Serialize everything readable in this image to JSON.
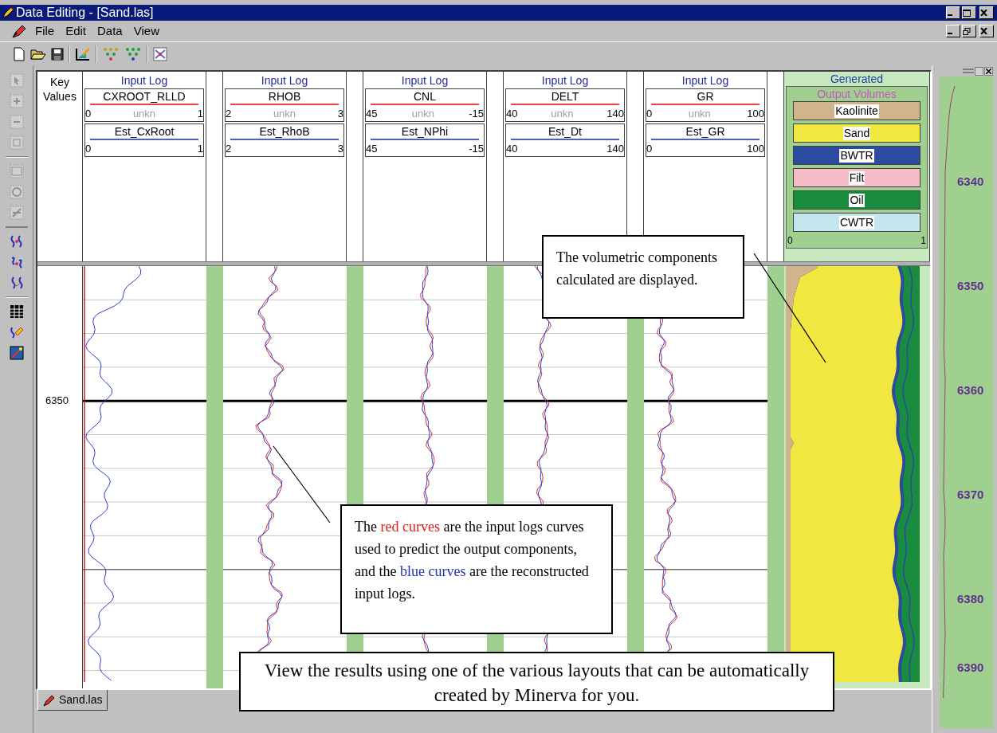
{
  "window": {
    "title": "Data Editing - [Sand.las]"
  },
  "menu": [
    "File",
    "Edit",
    "Data",
    "View"
  ],
  "key_values": {
    "label": "Key Values",
    "depth_label": "6350"
  },
  "tracks": [
    {
      "title": "Input Log",
      "input": {
        "name": "CXROOT_RLLD",
        "min": "0",
        "status": "unkn",
        "max": "1"
      },
      "estimated": {
        "name": "Est_CxRoot",
        "min": "0",
        "max": "1"
      }
    },
    {
      "title": "Input Log",
      "input": {
        "name": "RHOB",
        "min": "2",
        "status": "unkn",
        "max": "3"
      },
      "estimated": {
        "name": "Est_RhoB",
        "min": "2",
        "max": "3"
      }
    },
    {
      "title": "Input Log",
      "input": {
        "name": "CNL",
        "min": "45",
        "status": "unkn",
        "max": "-15"
      },
      "estimated": {
        "name": "Est_NPhi",
        "min": "45",
        "max": "-15"
      }
    },
    {
      "title": "Input Log",
      "input": {
        "name": "DELT",
        "min": "40",
        "status": "unkn",
        "max": "140"
      },
      "estimated": {
        "name": "Est_Dt",
        "min": "40",
        "max": "140"
      }
    },
    {
      "title": "Input Log",
      "input": {
        "name": "GR",
        "min": "0",
        "status": "unkn",
        "max": "100"
      },
      "estimated": {
        "name": "Est_GR",
        "min": "0",
        "max": "100"
      }
    }
  ],
  "generated": {
    "title": "Generated",
    "subtitle": "Output Volumes",
    "components": [
      {
        "name": "Kaolinite",
        "color": "#d2b48c"
      },
      {
        "name": "Sand",
        "color": "#f0e840"
      },
      {
        "name": "BWTR",
        "color": "#2c4aa0"
      },
      {
        "name": "Filt",
        "color": "#f8bcc8"
      },
      {
        "name": "Oil",
        "color": "#1a8c40"
      },
      {
        "name": "CWTR",
        "color": "#c4e6ee"
      }
    ],
    "scale_min": "0",
    "scale_max": "1"
  },
  "depth_track": {
    "labels": [
      "6340",
      "6350",
      "6360",
      "6370",
      "6380",
      "6390"
    ]
  },
  "callouts": [
    {
      "segments": [
        {
          "text": "The volumetric components calculated are displayed.",
          "color": "#000000"
        }
      ]
    },
    {
      "segments": [
        {
          "text": "The ",
          "color": "#000000"
        },
        {
          "text": "red curves",
          "color": "#e02020"
        },
        {
          "text": " are the input logs curves used to predict the output components, and the ",
          "color": "#000000"
        },
        {
          "text": "blue curves",
          "color": "#2030b0"
        },
        {
          "text": " are the reconstructed input logs.",
          "color": "#000000"
        }
      ]
    },
    {
      "segments": [
        {
          "text": "View the results using one of the various layouts that can be automatically created by Minerva for you.",
          "color": "#000000"
        }
      ]
    }
  ],
  "tabs": [
    {
      "label": "Sand.las",
      "selected": true
    }
  ]
}
